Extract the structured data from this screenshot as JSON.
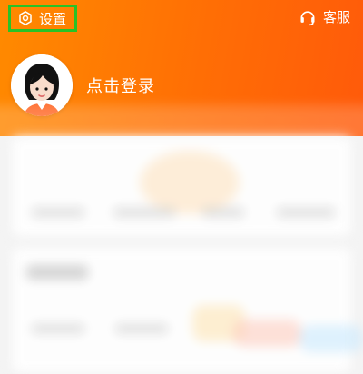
{
  "header": {
    "settings_label": "设置",
    "customer_service_label": "客服",
    "login_prompt": "点击登录"
  },
  "icons": {
    "settings": "gear-icon",
    "customer_service": "headset-icon",
    "avatar": "avatar"
  },
  "colors": {
    "header_gradient": [
      "#ff8a00",
      "#ff5a0a"
    ],
    "highlight_border": "#27c227",
    "text_on_header": "#ffffff"
  }
}
